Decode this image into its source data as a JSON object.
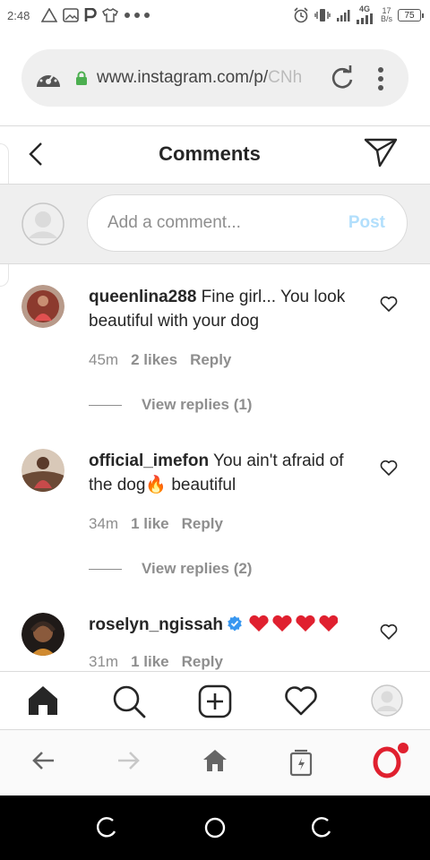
{
  "status_bar": {
    "time": "2:48",
    "network": "4G",
    "net_speed_value": "17",
    "net_speed_unit": "B/s",
    "battery": "75"
  },
  "browser": {
    "url_main": "www.instagram.com/p/",
    "url_faded": "CNh",
    "icons": [
      "speed-dial-icon",
      "lock-icon",
      "reload-icon",
      "more-vertical-icon"
    ]
  },
  "header": {
    "title": "Comments"
  },
  "composer": {
    "placeholder": "Add a comment...",
    "post_label": "Post"
  },
  "comments": [
    {
      "username": "queenlina288",
      "text": "Fine girl... You look beautiful with your dog",
      "time": "45m",
      "likes": "2 likes",
      "reply": "Reply",
      "view_replies": "View replies (1)"
    },
    {
      "username": "official_imefon",
      "text": "You ain't afraid of the dog",
      "emoji_suffix": "🔥",
      "text_after": " beautiful",
      "time": "34m",
      "likes": "1 like",
      "reply": "Reply",
      "view_replies": "View replies (2)"
    },
    {
      "username": "roselyn_ngissah",
      "verified": true,
      "emoji_text": "❤️❤️❤️❤️",
      "time": "31m",
      "likes": "1 like",
      "reply": "Reply"
    }
  ],
  "colors": {
    "post_disabled": "#b2dffc",
    "muted": "#8e8e8e",
    "verified": "#3897f0",
    "heart_red": "#e0202f",
    "opera_red": "#e0202f"
  }
}
